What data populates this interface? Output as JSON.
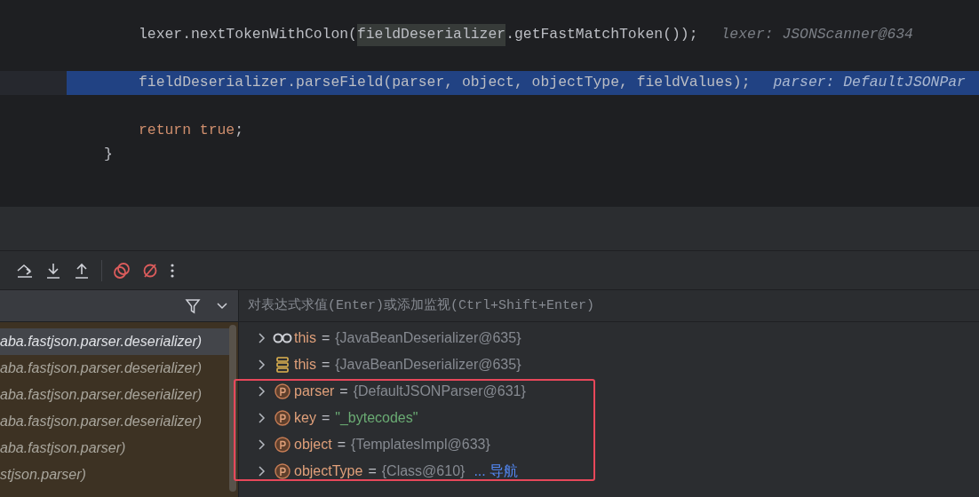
{
  "editor": {
    "lines": [
      {
        "kind": "block",
        "children": [
          {
            "kind": "code",
            "segments": [
              {
                "text": "lexer.nextTokenWithColon(",
                "kind": "plain"
              },
              {
                "text": "fieldDeserializer",
                "kind": "usage"
              },
              {
                "text": ".getFastMatchToken());",
                "kind": "plain"
              }
            ],
            "hint": "lexer: JSONScanner@634",
            "selected": false
          },
          {
            "kind": "blank"
          },
          {
            "kind": "code",
            "segments": [
              {
                "text": "fieldDeserializer.parseField(parser, object, objectType, fieldValues);",
                "kind": "plain"
              }
            ],
            "hint": "parser: DefaultJSONPar",
            "selected": true
          },
          {
            "kind": "blank"
          },
          {
            "kind": "code",
            "segments": [
              {
                "text": "return ",
                "kind": "keyword"
              },
              {
                "text": "true",
                "kind": "keyword"
              },
              {
                "text": ";",
                "kind": "plain"
              }
            ],
            "selected": false
          }
        ]
      },
      {
        "kind": "code",
        "segments": [
          {
            "text": "}",
            "kind": "plain"
          }
        ],
        "selected": false
      }
    ]
  },
  "debugger": {
    "frames": {
      "items": [
        {
          "text": "aba.fastjson.parser.deserializer)",
          "selected": true
        },
        {
          "text": "aba.fastjson.parser.deserializer)",
          "selected": false
        },
        {
          "text": "aba.fastjson.parser.deserializer)",
          "selected": false
        },
        {
          "text": "aba.fastjson.parser.deserializer)",
          "selected": false
        },
        {
          "text": "aba.fastjson.parser)",
          "selected": false
        },
        {
          "text": "stjson.parser)",
          "selected": false
        }
      ]
    },
    "evaluate": {
      "placeholder": "对表达式求值(Enter)或添加监视(Ctrl+Shift+Enter)"
    },
    "variables": [
      {
        "kind": "watch",
        "name": "this",
        "separator": "=",
        "value": {
          "text": "{JavaBeanDeserializer@635}",
          "kind": "object"
        }
      },
      {
        "kind": "field",
        "name": "this",
        "separator": "=",
        "value": {
          "text": "{JavaBeanDeserializer@635}",
          "kind": "object"
        }
      },
      {
        "kind": "param",
        "name": "parser",
        "separator": "=",
        "value": {
          "text": "{DefaultJSONParser@631}",
          "kind": "object"
        }
      },
      {
        "kind": "param",
        "name": "key",
        "separator": "=",
        "value": {
          "text": "\"_bytecodes\"",
          "kind": "string"
        }
      },
      {
        "kind": "param",
        "name": "object",
        "separator": "=",
        "value": {
          "text": "{TemplatesImpl@633}",
          "kind": "object"
        }
      },
      {
        "kind": "param",
        "name": "objectType",
        "separator": "=",
        "value": {
          "text": "{Class@610}",
          "kind": "object"
        },
        "link": "... 导航"
      }
    ]
  }
}
